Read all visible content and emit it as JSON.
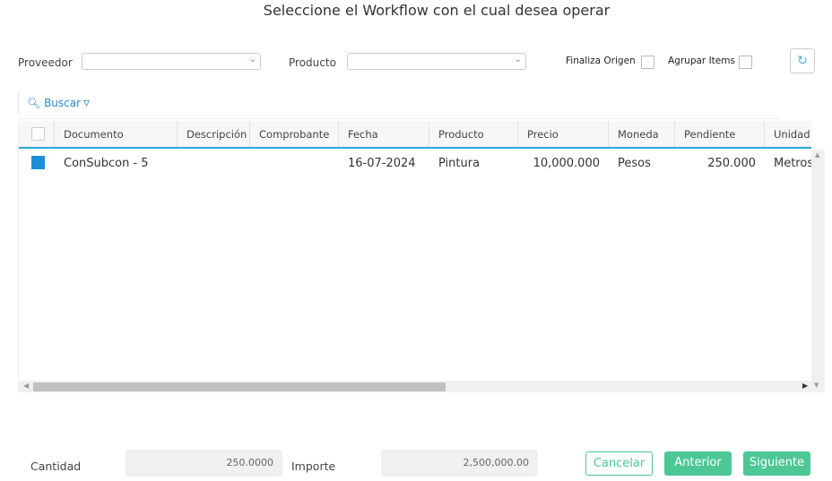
{
  "title": "Seleccione el Workflow con el cual desea operar",
  "filters": {
    "proveedor_label": "Proveedor",
    "producto_label": "Producto",
    "finaliza_label": "Finaliza Origen",
    "agrupar_label": "Agrupar Items"
  },
  "toolbar": {
    "buscar": "Buscar"
  },
  "table": {
    "columns": [
      "Documento",
      "Descripción",
      "Comprobante",
      "Fecha",
      "Producto",
      "Precio",
      "Moneda",
      "Pendiente",
      "Unidad"
    ],
    "rows": [
      {
        "checked": true,
        "cells": [
          "ConSubcon - 5",
          "",
          "",
          "16-07-2024",
          "Pintura",
          "10,000.000",
          "Pesos",
          "250.000",
          "Metros"
        ]
      }
    ]
  },
  "footer": {
    "cantidad_label": "Cantidad",
    "cantidad": "250.0000",
    "importe_label": "Importe",
    "importe": "2,500,000.00",
    "cancelar": "Cancelar",
    "anterior": "Anterior",
    "siguiente": "Siguiente"
  },
  "colors": {
    "accent": "#4cc795",
    "link": "#2a87d0",
    "header_border": "#2aa8dc"
  }
}
